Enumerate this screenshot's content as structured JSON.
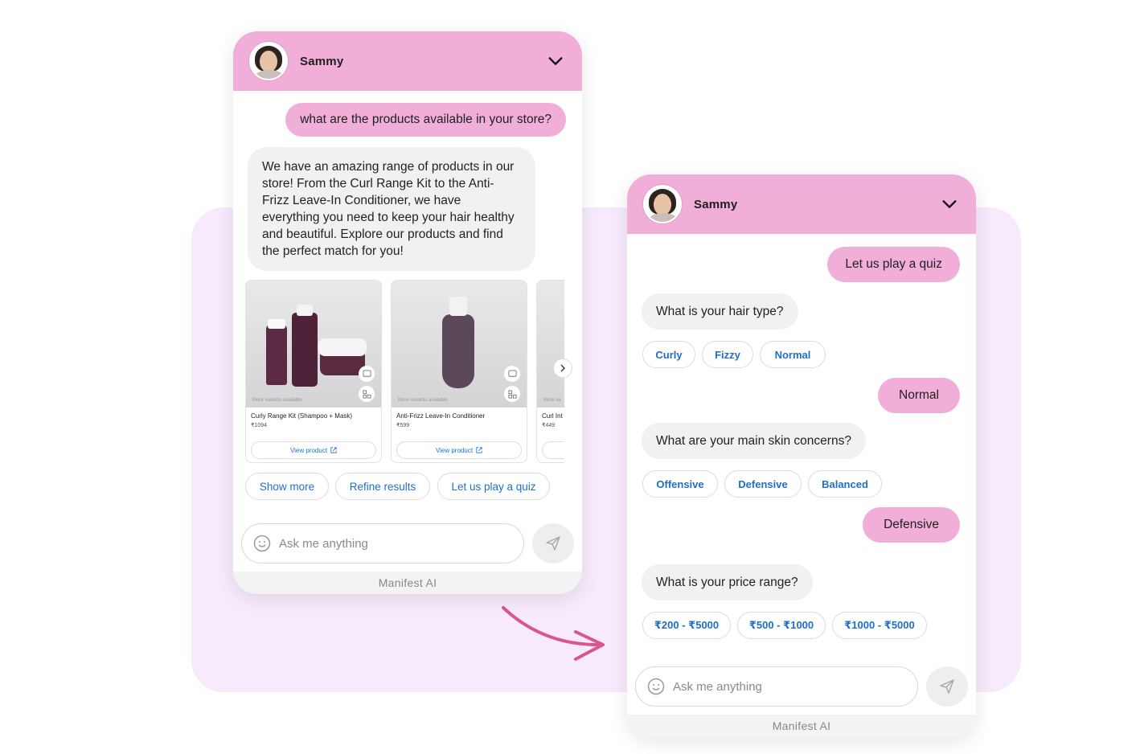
{
  "left_widget": {
    "agent_name": "Sammy",
    "user_message": "what are the products available in your store?",
    "bot_message": "We have an amazing range of products in our store! From the Curl Range Kit to the Anti-Frizz Leave-In Conditioner, we have everything you need to keep your hair healthy and beautiful. Explore our products and find the perfect match for you!",
    "products": [
      {
        "title": "Curly Range Kit (Shampoo + Mask)",
        "price": "₹1094",
        "variants": "More variants available",
        "button": "View product"
      },
      {
        "title": "Anti-Frizz Leave-In Conditioner",
        "price": "₹599",
        "variants": "More variants available",
        "button": "View product"
      },
      {
        "title": "Curl Int",
        "price": "₹449",
        "variants": "More va",
        "button": ""
      }
    ],
    "suggestions": [
      "Show more",
      "Refine results",
      "Let us play a quiz"
    ],
    "input_placeholder": "Ask me anything",
    "footer": "Manifest AI"
  },
  "right_widget": {
    "agent_name": "Sammy",
    "messages": {
      "user_1": "Let us play a quiz",
      "bot_1": "What is your hair type?",
      "options_1": [
        "Curly",
        "Fizzy",
        "Normal"
      ],
      "user_2": "Normal",
      "bot_2": "What are your main skin concerns?",
      "options_2": [
        "Offensive",
        "Defensive",
        "Balanced"
      ],
      "user_3": "Defensive",
      "bot_3": "What is your price range?",
      "options_3": [
        "₹200 - ₹5000",
        "₹500 - ₹1000",
        "₹1000 - ₹5000"
      ]
    },
    "input_placeholder": "Ask me anything",
    "footer": "Manifest AI"
  },
  "colors": {
    "header": "#f1aed9",
    "user_bubble": "#f1aed9",
    "bot_bubble": "#f1f1f1",
    "link": "#1f6fc9",
    "background_panel": "#f7eafc",
    "arrow": "#d9558a"
  }
}
